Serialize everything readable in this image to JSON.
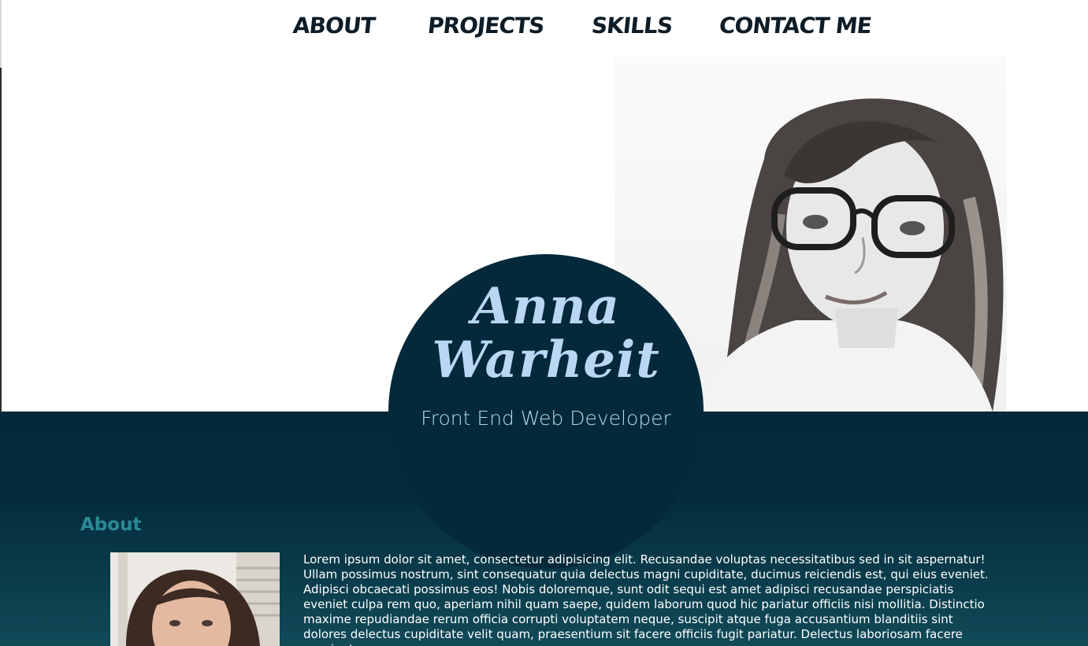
{
  "nav": {
    "items": [
      {
        "label": "ABOUT"
      },
      {
        "label": "PROJECTS"
      },
      {
        "label": "SKILLS"
      },
      {
        "label": "CONTACT ME"
      }
    ]
  },
  "hero": {
    "name_line1": "Anna",
    "name_line2": "Warheit",
    "subtitle": "Front End Web Developer",
    "portrait_icon": "portrait-photo"
  },
  "about": {
    "heading": "About",
    "photo_icon": "profile-photo",
    "paragraph": "Lorem ipsum dolor sit amet, consectetur adipisicing elit. Recusandae voluptas necessitatibus sed in sit aspernatur! Ullam possimus nostrum, sint consequatur quia delectus magni cupiditate, ducimus reiciendis est, qui eius eveniet. Adipisci obcaecati possimus eos! Nobis doloremque, sunt odit sequi est amet adipisci recusandae perspiciatis eveniet culpa rem quo, aperiam nihil quam saepe, quidem laborum quod hic pariatur officiis nisi mollitia. Distinctio maxime repudiandae rerum officia corrupti voluptatem neque, suscipit atque fuga accusantium blanditiis sint dolores delectus cupiditate velit quam, praesentium sit facere officiis fugit pariatur. Delectus laboriosam facere nesciunt"
  },
  "colors": {
    "navy": "#03293a",
    "teal_heading": "#2a8a96",
    "light_blue": "#b9d7f2"
  }
}
